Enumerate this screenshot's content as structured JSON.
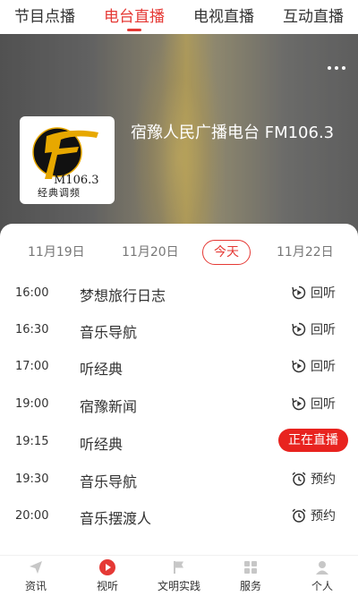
{
  "top_tabs": [
    {
      "label": "节目点播",
      "active": false
    },
    {
      "label": "电台直播",
      "active": true
    },
    {
      "label": "电视直播",
      "active": false
    },
    {
      "label": "互动直播",
      "active": false
    }
  ],
  "station": {
    "name": "宿豫人民广播电台 FM106.3",
    "logo": {
      "brand_text": "M106.3",
      "subtitle": "经典调频"
    }
  },
  "dates": [
    {
      "label": "11月19日",
      "active": false
    },
    {
      "label": "11月20日",
      "active": false
    },
    {
      "label": "今天",
      "active": true
    },
    {
      "label": "11月22日",
      "active": false
    }
  ],
  "schedule": [
    {
      "time": "16:00",
      "title": "梦想旅行日志",
      "action": "回听",
      "action_type": "replay"
    },
    {
      "time": "16:30",
      "title": "音乐导航",
      "action": "回听",
      "action_type": "replay"
    },
    {
      "time": "17:00",
      "title": "听经典",
      "action": "回听",
      "action_type": "replay"
    },
    {
      "time": "19:00",
      "title": "宿豫新闻",
      "action": "回听",
      "action_type": "replay"
    },
    {
      "time": "19:15",
      "title": "听经典",
      "action": "正在直播",
      "action_type": "live"
    },
    {
      "time": "19:30",
      "title": "音乐导航",
      "action": "预约",
      "action_type": "reserve"
    },
    {
      "time": "20:00",
      "title": "音乐摆渡人",
      "action": "预约",
      "action_type": "reserve"
    }
  ],
  "bottom_nav": [
    {
      "label": "资讯",
      "icon": "send-icon",
      "active": false
    },
    {
      "label": "视听",
      "icon": "play-circle-icon",
      "active": true
    },
    {
      "label": "文明实践",
      "icon": "flag-icon",
      "active": false
    },
    {
      "label": "服务",
      "icon": "grid-icon",
      "active": false
    },
    {
      "label": "个人",
      "icon": "user-icon",
      "active": false
    }
  ],
  "colors": {
    "accent": "#e53935",
    "live_badge": "#e8231f",
    "logo_gold": "#e7a800"
  }
}
